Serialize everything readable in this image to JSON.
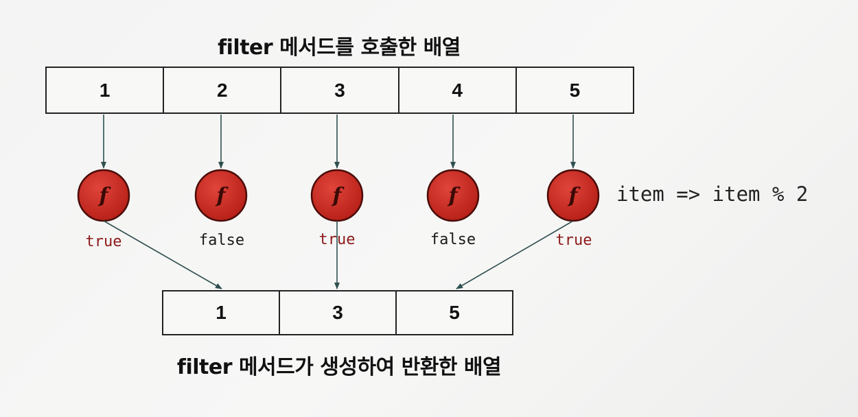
{
  "top_title": "filter 메서드를 호출한 배열",
  "bottom_title": "filter 메서드가 생성하여 반환한 배열",
  "input_array": [
    "1",
    "2",
    "3",
    "4",
    "5"
  ],
  "output_array": [
    "1",
    "3",
    "5"
  ],
  "callback_icon": "f",
  "results": [
    {
      "label": "true",
      "color": "#8b1a1a"
    },
    {
      "label": "false",
      "color": "#1a1a1a"
    },
    {
      "label": "true",
      "color": "#8b1a1a"
    },
    {
      "label": "false",
      "color": "#1a1a1a"
    },
    {
      "label": "true",
      "color": "#8b1a1a"
    }
  ],
  "callback_expression": "item => item % 2",
  "colors": {
    "circle_fill": "#cc2a22",
    "circle_stroke": "#4a0c08",
    "line": "#2f4f4f",
    "result_true": "#8b1a1a",
    "result_false": "#1a1a1a"
  }
}
